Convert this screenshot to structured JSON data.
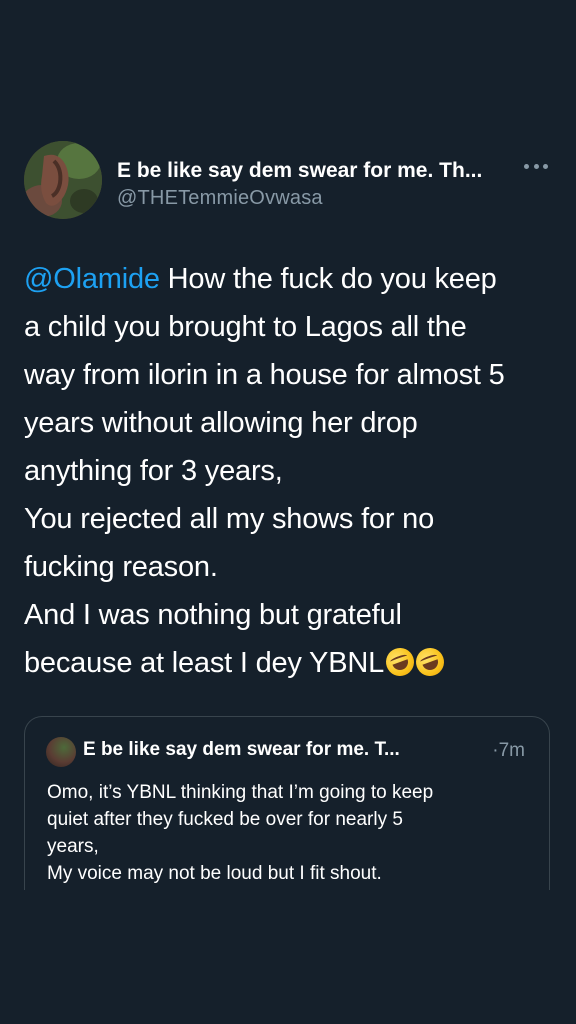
{
  "tweet": {
    "display_name": "E be like say dem swear for me. Th...",
    "handle": "@THETemmieOvwasa",
    "more_icon": "more-horizontal-icon",
    "mention": "@Olamide",
    "lines": [
      " How the fuck do you keep",
      "a child you brought to Lagos all the",
      "way from ilorin in a house for almost 5",
      "years without allowing her drop",
      "anything for 3 years,",
      "You rejected all my shows for no",
      "fucking reason.",
      "And I was nothing but grateful",
      "because at least I dey YBNL"
    ],
    "emojis": [
      "rolling-on-floor-laughing-emoji",
      "rolling-on-floor-laughing-emoji"
    ]
  },
  "quoted_tweet": {
    "display_name": "E be like say dem swear for me. T...",
    "time": "·7m",
    "lines": [
      "Omo, it’s YBNL thinking that I’m going to keep",
      "quiet after they fucked be over for nearly 5",
      "years,",
      "My voice may not be loud but I fit shout."
    ]
  },
  "colors": {
    "background": "#15202b",
    "text": "#ffffff",
    "secondary_text": "#8899a6",
    "link": "#1da1f2",
    "border": "#38444d"
  }
}
